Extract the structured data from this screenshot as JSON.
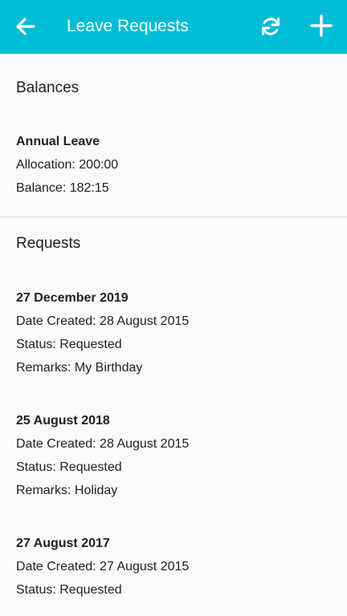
{
  "appbar": {
    "title": "Leave Requests",
    "back_icon": "arrow-left-icon",
    "refresh_icon": "refresh-icon",
    "add_icon": "plus-icon",
    "color": "#00bcd4"
  },
  "balances": {
    "heading": "Balances",
    "items": [
      {
        "type": "Annual Leave",
        "allocation": "Allocation: 200:00",
        "balance": "Balance: 182:15"
      }
    ]
  },
  "requests": {
    "heading": "Requests",
    "items": [
      {
        "date": "27 December 2019",
        "created": "Date Created: 28 August 2015",
        "status": "Status: Requested",
        "remarks": "Remarks: My Birthday"
      },
      {
        "date": "25 August 2018",
        "created": "Date Created: 28 August 2015",
        "status": "Status: Requested",
        "remarks": "Remarks: Holiday"
      },
      {
        "date": "27 August 2017",
        "created": "Date Created: 27 August 2015",
        "status": "Status: Requested"
      }
    ]
  }
}
